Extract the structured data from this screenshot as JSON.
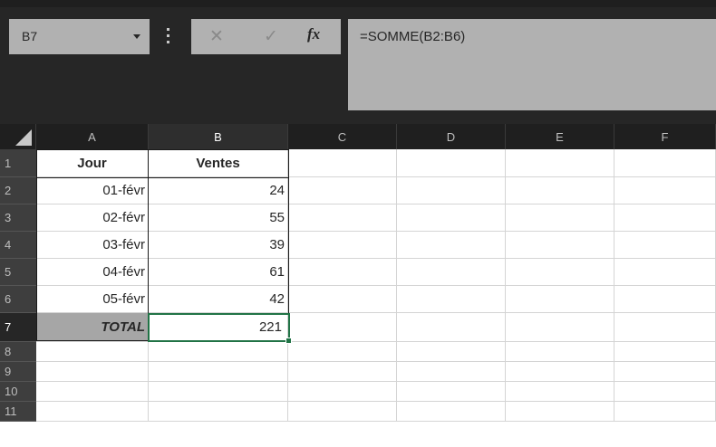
{
  "formula_bar": {
    "name_box": "B7",
    "cancel_icon": "✕",
    "enter_icon": "✓",
    "fx_label": "fx",
    "formula": "=SOMME(B2:B6)"
  },
  "columns": [
    "A",
    "B",
    "C",
    "D",
    "E",
    "F"
  ],
  "rows": [
    "1",
    "2",
    "3",
    "4",
    "5",
    "6",
    "7",
    "8",
    "9",
    "10",
    "11"
  ],
  "cells": {
    "A1": "Jour",
    "B1": "Ventes",
    "A2": "01-févr",
    "B2": "24",
    "A3": "02-févr",
    "B3": "55",
    "A4": "03-févr",
    "B4": "39",
    "A5": "04-févr",
    "B5": "61",
    "A6": "05-févr",
    "B6": "42",
    "A7": "TOTAL",
    "B7": "221"
  },
  "selection": {
    "active_cell": "B7",
    "active_column": "B",
    "active_row": "7"
  },
  "colors": {
    "selection": "#217346",
    "total_fill": "#a6a6a6",
    "header_bg": "#1f1f1f"
  }
}
